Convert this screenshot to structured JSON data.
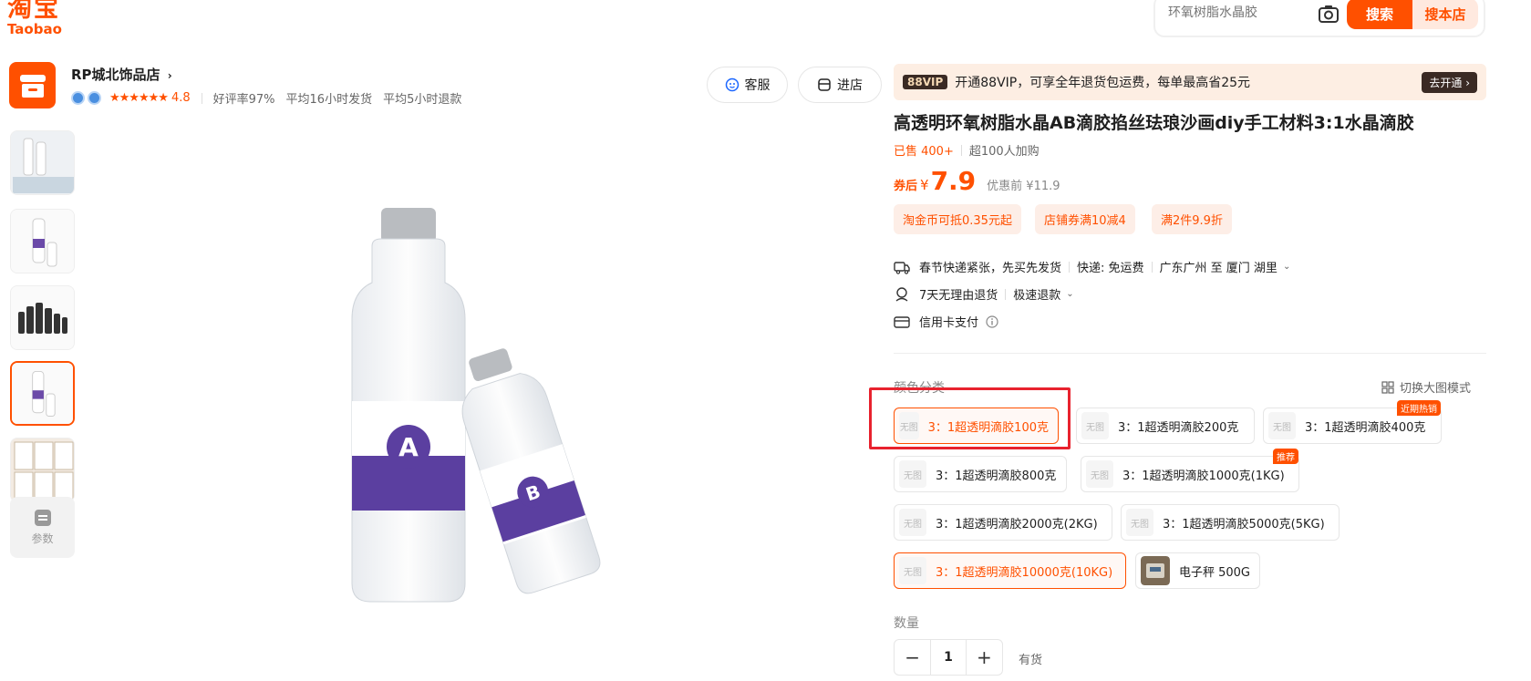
{
  "header": {
    "logo_cn": "淘宝",
    "logo_en": "Taobao",
    "search_placeholder": "环氧树脂水晶胶",
    "search_button": "搜索",
    "search_shop_button": "搜本店"
  },
  "shop": {
    "name": "RP城北饰品店",
    "rating_stars": "★★★★★★",
    "rating_score": "4.8",
    "good_rate": "好评率97%",
    "ship_time": "平均16小时发货",
    "refund_time": "平均5小时退款",
    "service_button": "客服",
    "enter_button": "进店"
  },
  "gallery": {
    "param_label": "参数",
    "thumbnail_count": 5
  },
  "product": {
    "vip_badge": "88VIP",
    "vip_text": "开通88VIP，可享全年退货包运费，每单最高省25元",
    "vip_open": "去开通",
    "title": "高透明环氧树脂水晶AB滴胶掐丝珐琅沙画diy手工材料3:1水晶滴胶",
    "sold": "已售 400+",
    "added": "超100人加购",
    "price_label": "券后",
    "price_currency": "¥",
    "price_value": "7.9",
    "price_original": "优惠前 ¥11.9",
    "coupons": [
      "淘金币可抵0.35元起",
      "店铺券满10减4",
      "满2件9.9折"
    ],
    "shipping_notice": "春节快递紧张，先买先发货",
    "shipping_fee": "快递: 免运费",
    "shipping_route": "广东广州 至 厦门 湖里",
    "return_policy": "7天无理由退货",
    "fast_refund": "极速退款",
    "credit_card": "信用卡支付"
  },
  "sku": {
    "section_label": "颜色分类",
    "switch_mode": "切换大图模式",
    "no_image": "无图",
    "options": [
      {
        "label": "3：1超透明滴胶100克",
        "selected": true
      },
      {
        "label": "3：1超透明滴胶200克",
        "selected": false
      },
      {
        "label": "3：1超透明滴胶400克",
        "selected": false,
        "tag": "近期热销"
      },
      {
        "label": "3：1超透明滴胶800克",
        "selected": false
      },
      {
        "label": "3：1超透明滴胶1000克(1KG)",
        "selected": false,
        "tag": "推荐"
      },
      {
        "label": "3：1超透明滴胶2000克(2KG)",
        "selected": false
      },
      {
        "label": "3：1超透明滴胶5000克(5KG)",
        "selected": false
      },
      {
        "label": "3：1超透明滴胶10000克(10KG)",
        "selected": true
      },
      {
        "label": "电子秤 500G",
        "selected": false
      }
    ]
  },
  "quantity": {
    "label": "数量",
    "value": "1",
    "minus": "−",
    "plus": "+",
    "stock": "有货"
  },
  "colors": {
    "brand": "#ff5000",
    "highlight": "#e8222e"
  }
}
